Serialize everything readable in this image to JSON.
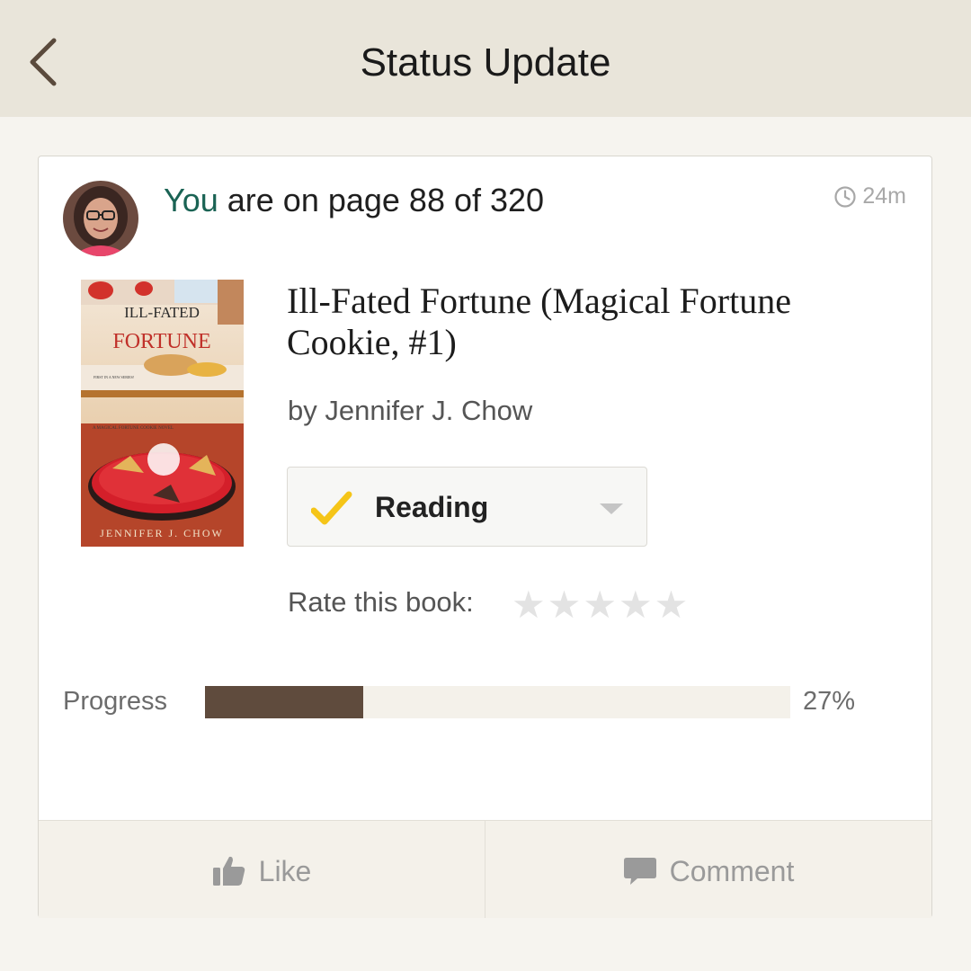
{
  "header": {
    "title": "Status Update",
    "back_icon": "chevron-left-icon"
  },
  "update": {
    "actor": "You",
    "status_text": "are on page 88 of 320",
    "current_page": 88,
    "total_pages": 320,
    "timestamp": "24m",
    "timestamp_icon": "clock-icon"
  },
  "book": {
    "title": "Ill-Fated Fortune (Magical Fortune Cookie, #1)",
    "author_line": "by Jennifer J. Chow",
    "cover": {
      "title_line1": "ILL-FATED",
      "title_line2": "FORTUNE",
      "series_note": "FIRST IN A NEW SERIES!",
      "series_line": "A MAGICAL FORTUNE COOKIE NOVEL",
      "author": "JENNIFER J. CHOW"
    }
  },
  "shelf": {
    "selected": "Reading",
    "check_icon": "checkmark-icon",
    "dropdown_icon": "caret-down-icon"
  },
  "rating": {
    "label": "Rate this book:",
    "stars_filled": 0,
    "stars_total": 5
  },
  "progress": {
    "label": "Progress",
    "percent": 27,
    "percent_text": "27%"
  },
  "actions": {
    "like_label": "Like",
    "like_icon": "thumbs-up-icon",
    "comment_label": "Comment",
    "comment_icon": "speech-bubble-icon"
  },
  "colors": {
    "header_bg": "#e9e5da",
    "page_bg": "#f6f4ef",
    "you_green": "#1a6354",
    "progress_fill": "#5f4b3d",
    "progress_track": "#f4f1ea",
    "check_yellow": "#f5c518"
  }
}
